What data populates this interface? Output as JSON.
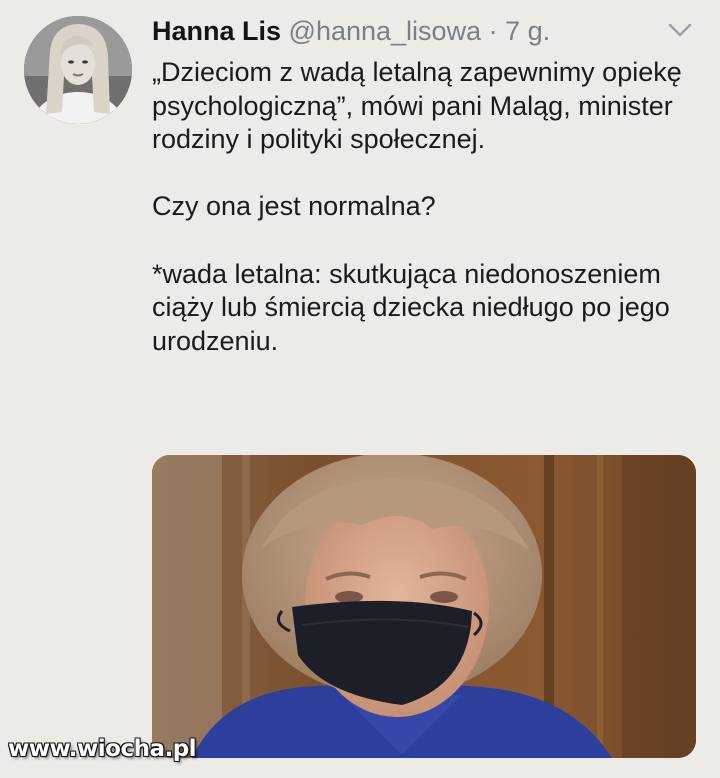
{
  "tweet": {
    "author": {
      "display_name": "Hanna Lis",
      "handle": "@hanna_lisowa"
    },
    "separator": "·",
    "time": "7 g.",
    "paragraphs": [
      "„Dzieciom z wadą letalną zapewnimy opiekę psychologiczną”, mówi pani Maląg, minister rodziny i polityki społecznej.",
      "Czy ona jest normalna?",
      "*wada letalna: skutkująca niedonoszeniem ciąży lub śmiercią dziecka niedługo po jego urodzeniu."
    ],
    "menu_icon": "chevron-down-icon",
    "media_description_icon": "photo"
  },
  "watermark": {
    "text": "www.wiocha.pl"
  },
  "colors": {
    "background": "#ecebe7",
    "text": "#1b1b1b",
    "secondary_text": "#7a7f86",
    "jacket": "#2c3f9c",
    "mask": "#1c1f27"
  }
}
